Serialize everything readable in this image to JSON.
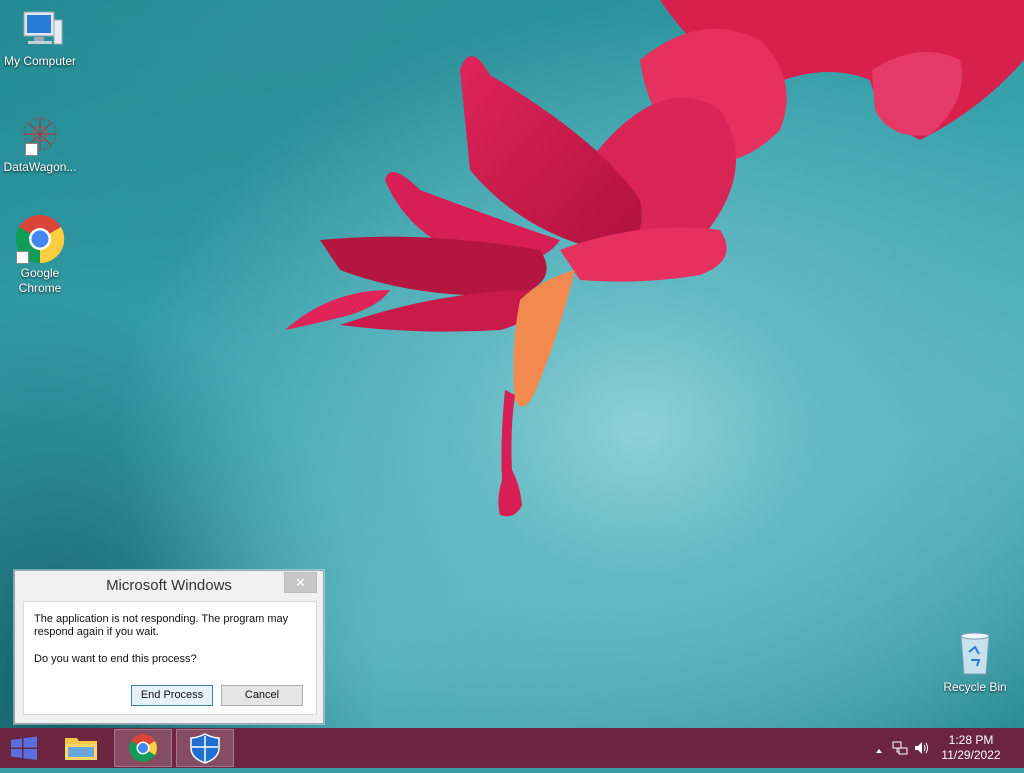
{
  "desktop": {
    "icons": [
      {
        "name": "my-computer",
        "label": "My Computer"
      },
      {
        "name": "datawagon",
        "label": "DataWagon..."
      },
      {
        "name": "google-chrome",
        "label": "Google Chrome"
      },
      {
        "name": "recycle-bin",
        "label": "Recycle Bin"
      }
    ]
  },
  "dialog": {
    "title": "Microsoft Windows",
    "close_glyph": "✕",
    "message": "The application is not responding. The program may respond again if you wait.",
    "question": "Do you want to end this process?",
    "end_button": "End Process",
    "cancel_button": "Cancel"
  },
  "taskbar": {
    "apps": [
      {
        "name": "file-explorer",
        "icon": "folder-icon"
      },
      {
        "name": "google-chrome",
        "icon": "chrome-icon"
      },
      {
        "name": "windows-defender",
        "icon": "shield-icon"
      }
    ],
    "tray": {
      "time": "1:28 PM",
      "date": "11/29/2022"
    }
  },
  "colors": {
    "taskbar": "#6b2540",
    "accent": "#3c7fb1"
  }
}
